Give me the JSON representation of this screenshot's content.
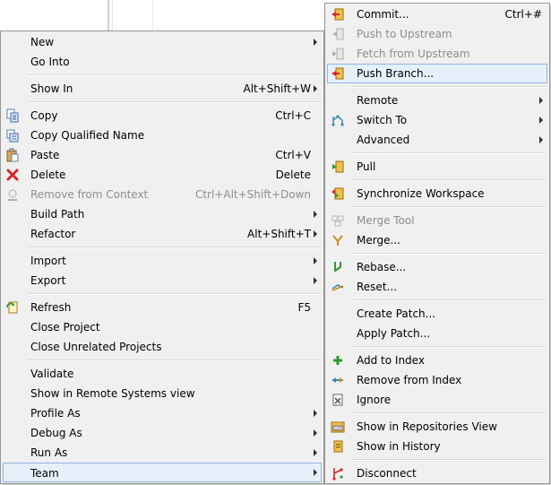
{
  "context_menu": {
    "items": [
      {
        "label": "New",
        "shortcut": "",
        "submenu": true
      },
      {
        "label": "Go Into",
        "shortcut": ""
      },
      {
        "label": "Show In",
        "shortcut": "Alt+Shift+W",
        "submenu": true
      },
      {
        "label": "Copy",
        "shortcut": "Ctrl+C",
        "icon": "copy-icon"
      },
      {
        "label": "Copy Qualified Name",
        "shortcut": "",
        "icon": "copy-qualified-name-icon"
      },
      {
        "label": "Paste",
        "shortcut": "Ctrl+V",
        "icon": "paste-icon"
      },
      {
        "label": "Delete",
        "shortcut": "Delete",
        "icon": "delete-icon"
      },
      {
        "label": "Remove from Context",
        "shortcut": "Ctrl+Alt+Shift+Down",
        "disabled": true,
        "icon": "remove-from-context-icon"
      },
      {
        "label": "Build Path",
        "shortcut": "",
        "submenu": true
      },
      {
        "label": "Refactor",
        "shortcut": "Alt+Shift+T",
        "submenu": true
      },
      {
        "label": "Import",
        "shortcut": "",
        "submenu": true
      },
      {
        "label": "Export",
        "shortcut": "",
        "submenu": true
      },
      {
        "label": "Refresh",
        "shortcut": "F5",
        "icon": "refresh-icon"
      },
      {
        "label": "Close Project",
        "shortcut": ""
      },
      {
        "label": "Close Unrelated Projects",
        "shortcut": ""
      },
      {
        "label": "Validate",
        "shortcut": ""
      },
      {
        "label": "Show in Remote Systems view",
        "shortcut": ""
      },
      {
        "label": "Profile As",
        "shortcut": "",
        "submenu": true
      },
      {
        "label": "Debug As",
        "shortcut": "",
        "submenu": true
      },
      {
        "label": "Run As",
        "shortcut": "",
        "submenu": true
      },
      {
        "label": "Team",
        "shortcut": "",
        "submenu": true,
        "highlighted": true
      }
    ]
  },
  "team_menu": {
    "items": [
      {
        "label": "Commit...",
        "shortcut": "Ctrl+#",
        "icon": "commit-icon"
      },
      {
        "label": "Push to Upstream",
        "shortcut": "",
        "disabled": true,
        "icon": "push-upstream-icon"
      },
      {
        "label": "Fetch from Upstream",
        "shortcut": "",
        "disabled": true,
        "icon": "fetch-upstream-icon"
      },
      {
        "label": "Push Branch...",
        "shortcut": "",
        "hovered": true,
        "icon": "push-branch-icon"
      },
      {
        "label": "Remote",
        "shortcut": "",
        "submenu": true
      },
      {
        "label": "Switch To",
        "shortcut": "",
        "submenu": true,
        "icon": "switch-branch-icon"
      },
      {
        "label": "Advanced",
        "shortcut": "",
        "submenu": true
      },
      {
        "label": "Pull",
        "shortcut": "",
        "icon": "pull-icon"
      },
      {
        "label": "Synchronize Workspace",
        "shortcut": "",
        "icon": "synchronize-icon"
      },
      {
        "label": "Merge Tool",
        "shortcut": "",
        "disabled": true,
        "icon": "merge-tool-icon"
      },
      {
        "label": "Merge...",
        "shortcut": "",
        "icon": "merge-icon"
      },
      {
        "label": "Rebase...",
        "shortcut": "",
        "icon": "rebase-icon"
      },
      {
        "label": "Reset...",
        "shortcut": "",
        "icon": "reset-icon"
      },
      {
        "label": "Create Patch...",
        "shortcut": ""
      },
      {
        "label": "Apply Patch...",
        "shortcut": ""
      },
      {
        "label": "Add to Index",
        "shortcut": "",
        "icon": "add-to-index-icon"
      },
      {
        "label": "Remove from Index",
        "shortcut": "",
        "icon": "remove-from-index-icon"
      },
      {
        "label": "Ignore",
        "shortcut": "",
        "icon": "ignore-icon"
      },
      {
        "label": "Show in Repositories View",
        "shortcut": "",
        "icon": "repositories-view-icon"
      },
      {
        "label": "Show in History",
        "shortcut": "",
        "icon": "history-icon"
      },
      {
        "label": "Disconnect",
        "shortcut": "",
        "icon": "disconnect-icon"
      }
    ]
  }
}
